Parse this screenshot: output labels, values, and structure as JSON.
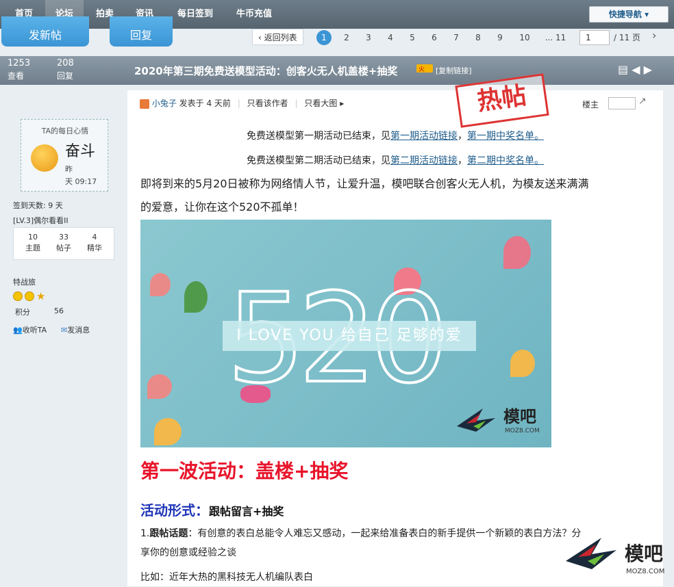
{
  "nav": {
    "items": [
      "首页",
      "论坛",
      "拍卖",
      "资讯",
      "每日签到",
      "牛币充值"
    ],
    "quick_nav": "快捷导航 ▾"
  },
  "toolbar": {
    "new_post": "发新帖",
    "reply": "回复",
    "back_to_list": "返回列表",
    "pages": [
      "1",
      "2",
      "3",
      "4",
      "5",
      "6",
      "7",
      "8",
      "9",
      "10",
      "... 11"
    ],
    "current_page": "1",
    "total_pages": "/ 11 页",
    "next": "›"
  },
  "thread": {
    "views_count": "1253",
    "views_label": "查看",
    "replies_count": "208",
    "replies_label": "回复",
    "title": "2020年第三期免费送模型活动：创客火无人机盖楼+抽奖",
    "copy_link": "[复制链接]"
  },
  "author": {
    "mood_header": "TA的每日心情",
    "mood_word": "奋斗",
    "mood_time1": "昨",
    "mood_time2": "天 09:17",
    "checkin_days": "签到天数: 9 天",
    "level": "[LV.3]偶尔看看II",
    "stats": [
      {
        "value": "10",
        "label": "主题"
      },
      {
        "value": "33",
        "label": "帖子"
      },
      {
        "value": "4",
        "label": "精华"
      }
    ],
    "group": "特战旅",
    "points_label": "积分",
    "points_value": "56",
    "follow": "收听TA",
    "message": "发消息"
  },
  "post": {
    "author_name": "小兔子",
    "posted": "发表于 4 天前",
    "only_author": "只看该作者",
    "big_image": "只看大图",
    "floor_label": "楼主",
    "stamp": "热帖",
    "line1_prefix": "免费送模型第一期活动已结束，见",
    "line1_link1": "第一期活动链接",
    "line1_sep": "，",
    "line1_link2": "第一期中奖名单。",
    "line2_prefix": "免费送模型第二期活动已结束，见",
    "line2_link1": "第二期活动链接",
    "line2_sep": "，",
    "line2_link2": "第二期中奖名单。",
    "intro1": "即将到来的5月20日被称为网络情人节，让爱升温，模吧联合创客火无人机，为模友送来满满",
    "intro2": "的爱意，让你在这个520不孤单！",
    "banner_number": "520",
    "banner_text": "I LOVE YOU 给自己 足够的爱",
    "logo_cn": "模吧",
    "logo_en": "MOZ8.COM",
    "heading1": "第一波活动：盖楼+抽奖",
    "heading2_label": "活动形式：",
    "heading2_value": "跟帖留言+抽奖",
    "rule1_num": "1.",
    "rule1_bold": "跟帖话题",
    "rule1_text": "：有创意的表白总能令人难忘又感动，一起来给准备表白的新手提供一个新颖的表白方法？分",
    "rule1_text2": "享你的创意或经验之谈",
    "example": "比如：近年大热的黑科技无人机编队表白"
  },
  "colors": {
    "nav_bg": "#5e6d79",
    "accent_blue": "#3b95d5",
    "heading_red": "#e8142a",
    "heading_blue": "#1f35b8",
    "link": "#1f5d8c"
  }
}
